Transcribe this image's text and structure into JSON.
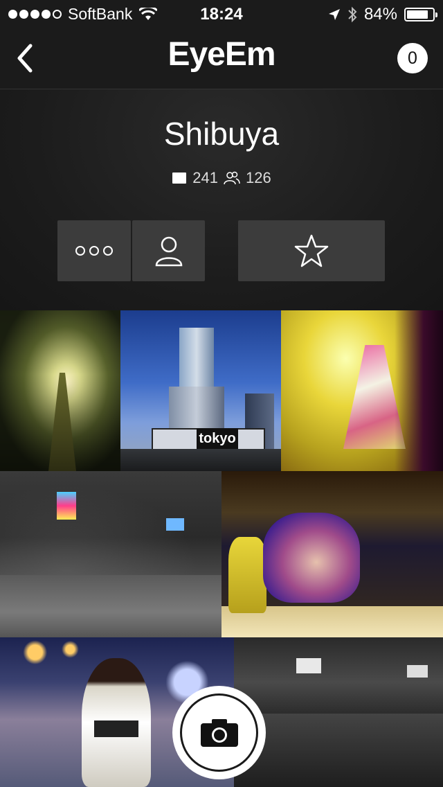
{
  "status_bar": {
    "carrier": "SoftBank",
    "time": "18:24",
    "battery_percent": "84%",
    "battery_level": 0.84,
    "signal_bars_filled": 4,
    "signal_bars_total": 5
  },
  "nav": {
    "back_icon": "chevron-left-icon",
    "title": "EyeEm",
    "notification_count": "0"
  },
  "header": {
    "album_title": "Shibuya",
    "photo_count": "241",
    "people_count": "126"
  },
  "actions": {
    "more_icon": "more-dots-icon",
    "person_icon": "person-icon",
    "star_icon": "star-icon"
  },
  "photos": [
    {
      "name": "photo-moving-walkway"
    },
    {
      "name": "photo-shibuya-tower-tokyo-sign",
      "caption": "tokyo"
    },
    {
      "name": "photo-graffiti-art"
    },
    {
      "name": "photo-night-crossing-rain"
    },
    {
      "name": "photo-face-portrait"
    },
    {
      "name": "photo-kimono-woman-night"
    },
    {
      "name": "photo-monochrome-street"
    }
  ],
  "camera": {
    "icon": "camera-icon"
  },
  "colors": {
    "background": "#141414",
    "bar": "#1b1b1b",
    "button": "#3c3c3c",
    "text": "#ffffff"
  }
}
